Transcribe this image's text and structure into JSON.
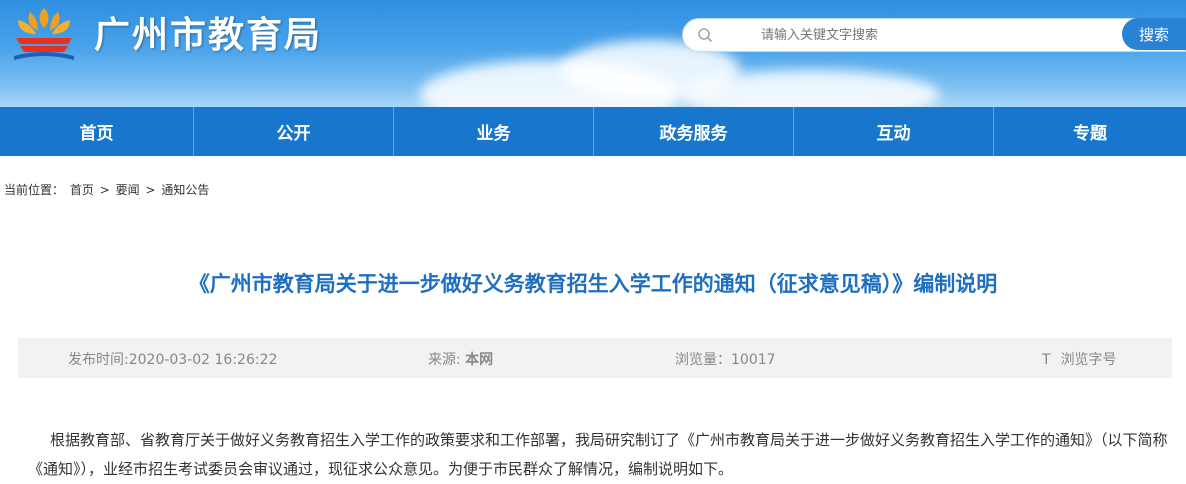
{
  "site": {
    "title": "广州市教育局",
    "search_placeholder": "请输入关键文字搜索",
    "search_button": "搜索"
  },
  "nav": {
    "items": [
      "首页",
      "公开",
      "业务",
      "政务服务",
      "互动",
      "专题"
    ]
  },
  "breadcrumb": {
    "prefix": "当前位置：",
    "items": [
      "首页",
      ">",
      "要闻",
      ">",
      "通知公告"
    ]
  },
  "article": {
    "title": "《广州市教育局关于进一步做好义务教育招生入学工作的通知（征求意见稿）》编制说明",
    "date": "发布时间:2020-03-02 16:26:22",
    "source_label": "来源: ",
    "source_value": "本网",
    "views": "浏览量：10017",
    "font_icon": "T",
    "font_label": "浏览字号",
    "body": "根据教育部、省教育厅关于做好义务教育招生入学工作的政策要求和工作部署，我局研究制订了《广州市教育局关于进一步做好义务教育招生入学工作的通知》（以下简称《通知》），业经市招生考试委员会审议通过，现征求公众意见。为便于市民群众了解情况，编制说明如下。"
  },
  "colors": {
    "nav_bg": "#1877cc",
    "title_blue": "#1f6fc0",
    "banner_blue": "#2f8fe0",
    "search_button": "#2a82d4"
  }
}
